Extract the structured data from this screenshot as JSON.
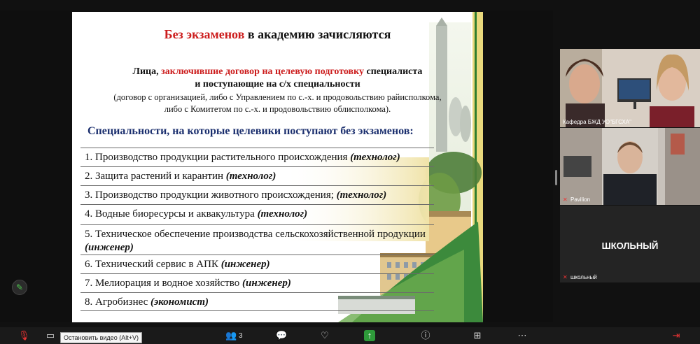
{
  "slide": {
    "title_red": "Без экзаменов",
    "title_rest": " в академию зачисляются",
    "line1_pre": "Лица, ",
    "line1_red": "заключившие договор на целевую подготовку",
    "line1_post": " специалиста",
    "line2": "и поступающие на с/х специальности",
    "line3": "(договор с организацией, либо с Управлением по с.-х. и продовольствию райисполкома,",
    "line4": "либо с Комитетом по с.-х. и продовольствию облисполкома).",
    "subtitle": "Специальности, на которые целевики поступают без экзаменов:",
    "specialties": [
      {
        "text": "1. Производство продукции растительного происхождения ",
        "role": "(технолог)"
      },
      {
        "text": "2. Защита растений и карантин ",
        "role": "(технолог)"
      },
      {
        "text": "3. Производство продукции животного происхождения; ",
        "role": "(технолог)"
      },
      {
        "text": "4. Водные биоресурсы и аквакультура ",
        "role": "(технолог)"
      },
      {
        "text": "5. Техническое обеспечение производства сельскохозяйственной продукции ",
        "role": "(инженер)"
      },
      {
        "text": "6. Технический сервис в АПК ",
        "role": "(инженер)"
      },
      {
        "text": "7. Мелиорация и водное хозяйство ",
        "role": "(инженер)"
      },
      {
        "text": "8. Агробизнес ",
        "role": "(экономист)"
      }
    ]
  },
  "participants": [
    {
      "name": "Кафедра БЖД УО\"БГСХА\""
    },
    {
      "name": "Pavilion"
    },
    {
      "name": "школьный",
      "display": "ШКОЛЬНЫЙ"
    }
  ],
  "toolbar": {
    "tooltip": "Остановить видео (Alt+V)",
    "participants_count": "3"
  },
  "colors": {
    "accent_green": "#3c8a3c",
    "title_red": "#cc1d1d",
    "subtitle_blue": "#1b2f6e"
  }
}
